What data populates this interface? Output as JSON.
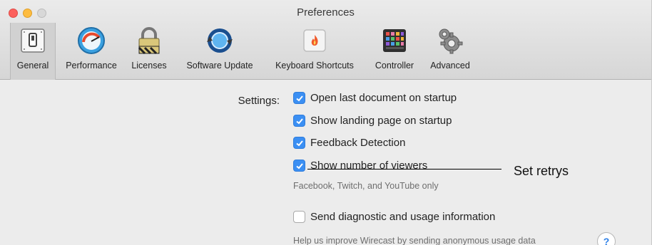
{
  "window": {
    "title": "Preferences"
  },
  "toolbar": {
    "tabs": [
      {
        "label": "General",
        "icon": "switch-icon",
        "selected": true
      },
      {
        "label": "Performance",
        "icon": "gauge-icon",
        "selected": false
      },
      {
        "label": "Licenses",
        "icon": "lock-icon",
        "selected": false
      },
      {
        "label": "Software Update",
        "icon": "sync-icon",
        "selected": false
      },
      {
        "label": "Keyboard Shortcuts",
        "icon": "flame-key-icon",
        "selected": false
      },
      {
        "label": "Controller",
        "icon": "pad-controller-icon",
        "selected": false
      },
      {
        "label": "Advanced",
        "icon": "gears-icon",
        "selected": false
      }
    ]
  },
  "settings": {
    "label": "Settings:",
    "options": [
      {
        "label": "Open last document on startup",
        "checked": true
      },
      {
        "label": "Show landing page on startup",
        "checked": true
      },
      {
        "label": "Feedback Detection",
        "checked": true
      },
      {
        "label": "Show number of viewers",
        "checked": true
      },
      {
        "label": "Send diagnostic and usage information",
        "checked": false
      }
    ],
    "viewers_note": "Facebook, Twitch, and YouTube only",
    "diagnostic_note": "Help us improve Wirecast by sending anonymous usage data",
    "help_glyph": "?"
  },
  "annotation": {
    "text": "Set retrys"
  },
  "colors": {
    "checkbox_accent": "#3b8ff3",
    "close": "#fc605c",
    "minimize": "#fdbc40"
  }
}
